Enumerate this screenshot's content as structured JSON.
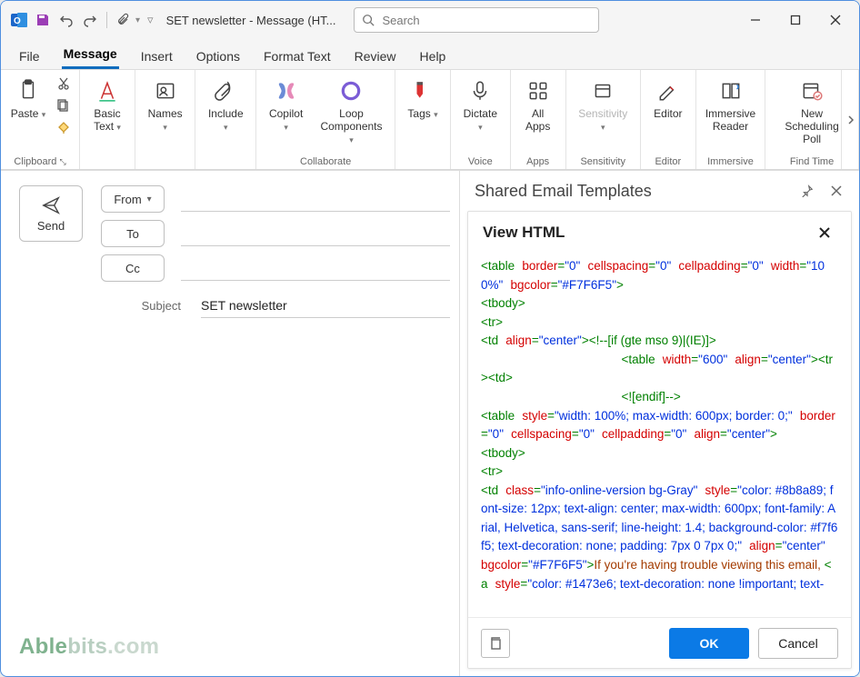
{
  "titlebar": {
    "doc_title": "SET newsletter - Message (HT...",
    "search_placeholder": "Search"
  },
  "menu": {
    "items": [
      "File",
      "Message",
      "Insert",
      "Options",
      "Format Text",
      "Review",
      "Help"
    ],
    "active": 1
  },
  "ribbon": {
    "groups": [
      {
        "label": "Clipboard",
        "tools": [
          {
            "label": "Paste",
            "drop": true
          }
        ],
        "extras": true
      },
      {
        "label": "",
        "tools": [
          {
            "label": "Basic\nText",
            "drop": true
          }
        ]
      },
      {
        "label": "",
        "tools": [
          {
            "label": "Names",
            "drop": true
          }
        ]
      },
      {
        "label": "",
        "tools": [
          {
            "label": "Include",
            "drop": true
          }
        ]
      },
      {
        "label": "Collaborate",
        "tools": [
          {
            "label": "Copilot",
            "drop": true
          },
          {
            "label": "Loop\nComponents",
            "drop": true
          }
        ]
      },
      {
        "label": "",
        "tools": [
          {
            "label": "Tags",
            "drop": true
          }
        ]
      },
      {
        "label": "Voice",
        "tools": [
          {
            "label": "Dictate",
            "drop": true
          }
        ]
      },
      {
        "label": "Apps",
        "tools": [
          {
            "label": "All\nApps"
          }
        ]
      },
      {
        "label": "Sensitivity",
        "tools": [
          {
            "label": "Sensitivity",
            "drop": true,
            "dim": true
          }
        ]
      },
      {
        "label": "Editor",
        "tools": [
          {
            "label": "Editor"
          }
        ]
      },
      {
        "label": "Immersive",
        "tools": [
          {
            "label": "Immersive\nReader"
          }
        ]
      },
      {
        "label": "Find Time",
        "tools": [
          {
            "label": "New\nScheduling Poll"
          }
        ]
      }
    ]
  },
  "compose": {
    "send": "Send",
    "from": "From",
    "to": "To",
    "cc": "Cc",
    "subject_label": "Subject",
    "subject_value": "SET newsletter"
  },
  "panel": {
    "title": "Shared Email Templates",
    "card_title": "View HTML",
    "ok": "OK",
    "cancel": "Cancel",
    "code": [
      {
        "t": "tag",
        "v": "<table"
      },
      {
        "t": "sp"
      },
      {
        "t": "attr",
        "v": "border"
      },
      {
        "t": "tag",
        "v": "="
      },
      {
        "t": "val",
        "v": "\"0\""
      },
      {
        "t": "sp"
      },
      {
        "t": "attr",
        "v": "cellspacing"
      },
      {
        "t": "tag",
        "v": "="
      },
      {
        "t": "val",
        "v": "\"0\""
      },
      {
        "t": "sp"
      },
      {
        "t": "attr",
        "v": "cellpadding"
      },
      {
        "t": "tag",
        "v": "="
      },
      {
        "t": "val",
        "v": "\"0\""
      },
      {
        "t": "sp"
      },
      {
        "t": "attr",
        "v": "width"
      },
      {
        "t": "tag",
        "v": "="
      },
      {
        "t": "val",
        "v": "\"100%\""
      },
      {
        "t": "sp"
      },
      {
        "t": "attr",
        "v": "bgcolor"
      },
      {
        "t": "tag",
        "v": "="
      },
      {
        "t": "val",
        "v": "\"#F7F6F5\""
      },
      {
        "t": "tag",
        "v": ">"
      },
      {
        "t": "br"
      },
      {
        "t": "tag",
        "v": "<tbody>"
      },
      {
        "t": "br"
      },
      {
        "t": "tag",
        "v": "<tr>"
      },
      {
        "t": "br"
      },
      {
        "t": "tag",
        "v": "<td"
      },
      {
        "t": "sp"
      },
      {
        "t": "attr",
        "v": "align"
      },
      {
        "t": "tag",
        "v": "="
      },
      {
        "t": "val",
        "v": "\"center\""
      },
      {
        "t": "tag",
        "v": ">"
      },
      {
        "t": "cm",
        "v": "<!--[if (gte mso 9)|(IE)]>"
      },
      {
        "t": "br"
      },
      {
        "t": "pad",
        "v": 19
      },
      {
        "t": "tag",
        "v": "<table"
      },
      {
        "t": "sp"
      },
      {
        "t": "attr",
        "v": "width"
      },
      {
        "t": "tag",
        "v": "="
      },
      {
        "t": "val",
        "v": "\"600\""
      },
      {
        "t": "sp"
      },
      {
        "t": "attr",
        "v": "align"
      },
      {
        "t": "tag",
        "v": "="
      },
      {
        "t": "val",
        "v": "\"center\""
      },
      {
        "t": "tag",
        "v": "><tr><td>"
      },
      {
        "t": "br"
      },
      {
        "t": "pad",
        "v": 19
      },
      {
        "t": "cm",
        "v": "<![endif]-->"
      },
      {
        "t": "br"
      },
      {
        "t": "tag",
        "v": "<table"
      },
      {
        "t": "sp"
      },
      {
        "t": "attr",
        "v": "style"
      },
      {
        "t": "tag",
        "v": "="
      },
      {
        "t": "val",
        "v": "\"width: 100%; max-width: 600px; border: 0;\""
      },
      {
        "t": "sp"
      },
      {
        "t": "attr",
        "v": "border"
      },
      {
        "t": "tag",
        "v": "="
      },
      {
        "t": "val",
        "v": "\"0\""
      },
      {
        "t": "sp"
      },
      {
        "t": "attr",
        "v": "cellspacing"
      },
      {
        "t": "tag",
        "v": "="
      },
      {
        "t": "val",
        "v": "\"0\""
      },
      {
        "t": "sp"
      },
      {
        "t": "attr",
        "v": "cellpadding"
      },
      {
        "t": "tag",
        "v": "="
      },
      {
        "t": "val",
        "v": "\"0\""
      },
      {
        "t": "sp"
      },
      {
        "t": "attr",
        "v": "align"
      },
      {
        "t": "tag",
        "v": "="
      },
      {
        "t": "val",
        "v": "\"center\""
      },
      {
        "t": "tag",
        "v": ">"
      },
      {
        "t": "br"
      },
      {
        "t": "tag",
        "v": "<tbody>"
      },
      {
        "t": "br"
      },
      {
        "t": "tag",
        "v": "<tr>"
      },
      {
        "t": "br"
      },
      {
        "t": "tag",
        "v": "<td"
      },
      {
        "t": "sp"
      },
      {
        "t": "attr",
        "v": "class"
      },
      {
        "t": "tag",
        "v": "="
      },
      {
        "t": "val",
        "v": "\"info-online-version bg-Gray\""
      },
      {
        "t": "sp"
      },
      {
        "t": "attr",
        "v": "style"
      },
      {
        "t": "tag",
        "v": "="
      },
      {
        "t": "val",
        "v": "\"color: #8b8a89; font-size: 12px; text-align: center; max-width: 600px; font-family: Arial, Helvetica, sans-serif; line-height: 1.4; background-color: #f7f6f5; text-decoration: none; padding: 7px 0 7px 0;\""
      },
      {
        "t": "sp"
      },
      {
        "t": "attr",
        "v": "align"
      },
      {
        "t": "tag",
        "v": "="
      },
      {
        "t": "val",
        "v": "\"center\""
      },
      {
        "t": "sp"
      },
      {
        "t": "attr",
        "v": "bgcolor"
      },
      {
        "t": "tag",
        "v": "="
      },
      {
        "t": "val",
        "v": "\"#F7F6F5\""
      },
      {
        "t": "tag",
        "v": ">"
      },
      {
        "t": "txt",
        "v": "If you're having trouble viewing this email, "
      },
      {
        "t": "tag",
        "v": "<a"
      },
      {
        "t": "sp"
      },
      {
        "t": "attr",
        "v": "style"
      },
      {
        "t": "tag",
        "v": "="
      },
      {
        "t": "val",
        "v": "\"color: #1473e6; text-decoration: none !important; text-"
      }
    ]
  },
  "watermark": "Ablebits.com"
}
